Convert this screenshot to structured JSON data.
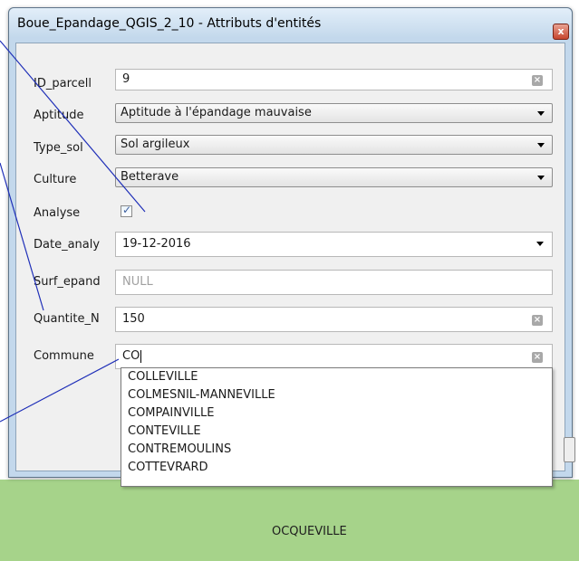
{
  "window": {
    "title": "Boue_Epandage_QGIS_2_10 - Attributs d'entités",
    "close_label": "x"
  },
  "form": {
    "id_parcell": {
      "label": "ID_parcell",
      "value": "9"
    },
    "aptitude": {
      "label": "Aptitude",
      "value": "Aptitude à l'épandage mauvaise"
    },
    "type_sol": {
      "label": "Type_sol",
      "value": "Sol argileux"
    },
    "culture": {
      "label": "Culture",
      "value": "Betterave"
    },
    "analyse": {
      "label": "Analyse",
      "checked": true
    },
    "date_analy": {
      "label": "Date_analy",
      "value": "19-12-2016"
    },
    "surf_epand": {
      "label": "Surf_epand",
      "value": "NULL"
    },
    "quantite_n": {
      "label": "Quantite_N",
      "value": "150"
    },
    "commune": {
      "label": "Commune",
      "value": "CO"
    }
  },
  "autocomplete": {
    "items": [
      "COLLEVILLE",
      "COLMESNIL-MANNEVILLE",
      "COMPAINVILLE",
      "CONTEVILLE",
      "CONTREMOULINS",
      "COTTEVRARD"
    ]
  },
  "map": {
    "label": "OCQUEVILLE",
    "background_color": "#a6d38a"
  },
  "annotation_color": "#1f2fb8",
  "icons": {
    "clear": "clear-field-icon",
    "dropdown": "chevron-down-icon",
    "check": "checkmark-icon"
  }
}
